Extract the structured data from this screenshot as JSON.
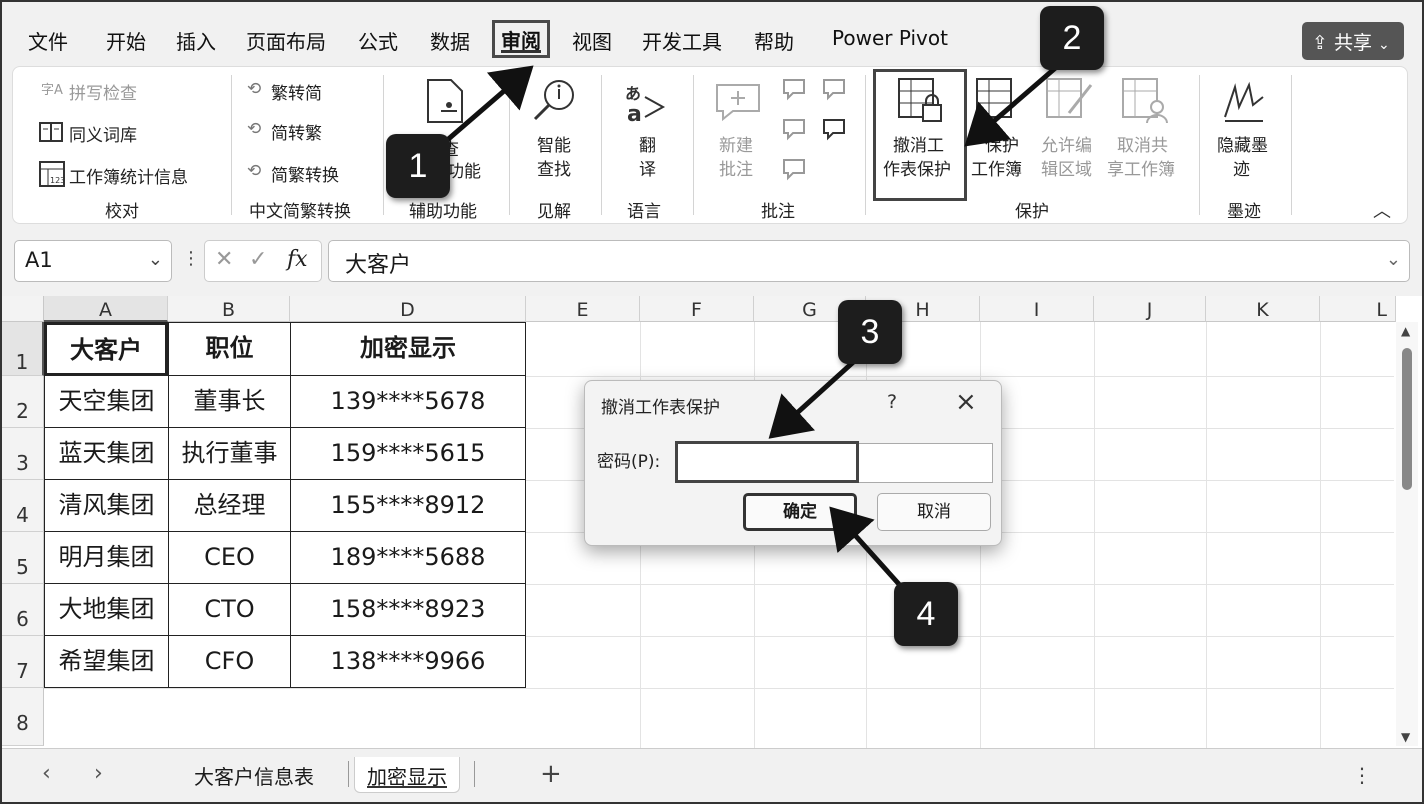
{
  "menu": {
    "file": "文件",
    "home": "开始",
    "insert": "插入",
    "layout": "页面布局",
    "formulas": "公式",
    "data": "数据",
    "review": "审阅",
    "view": "视图",
    "developer": "开发工具",
    "help": "帮助",
    "powerpivot": "Power Pivot",
    "share": "共享"
  },
  "ribbon": {
    "proofing": {
      "spell": "拼写检查",
      "thesaurus": "同义词库",
      "stats": "工作簿统计信息",
      "label": "校对"
    },
    "chinese": {
      "t2s": "繁转简",
      "s2t": "简转繁",
      "convert": "简繁转换",
      "label": "中文简繁转换"
    },
    "accessibility": {
      "check_line1": "检查",
      "check_line2": "辅助功能",
      "label": "辅助功能"
    },
    "insights": {
      "smart_line1": "智能",
      "smart_line2": "查找",
      "label": "见解"
    },
    "language": {
      "translate_line1": "翻",
      "translate_line2": "译",
      "label": "语言"
    },
    "comments": {
      "new_line1": "新建",
      "new_line2": "批注",
      "label": "批注"
    },
    "protect": {
      "unprotect_line1": "撤消工",
      "unprotect_line2": "作表保护",
      "workbook_line1": "保护",
      "workbook_line2": "工作簿",
      "allow_line1": "允许编",
      "allow_line2": "辑区域",
      "unshare_line1": "取消共",
      "unshare_line2": "享工作簿",
      "label": "保护"
    },
    "ink": {
      "hide_line1": "隐藏墨",
      "hide_line2": "迹",
      "label": "墨迹"
    }
  },
  "formula_bar": {
    "name_box": "A1",
    "fx": "fx",
    "content": "大客户"
  },
  "columns": [
    "A",
    "B",
    "D",
    "E",
    "F",
    "G",
    "H",
    "I",
    "J",
    "K",
    "L"
  ],
  "rows": [
    "1",
    "2",
    "3",
    "4",
    "5",
    "6",
    "7",
    "8"
  ],
  "table": {
    "headers": [
      "大客户",
      "职位",
      "加密显示"
    ],
    "rows": [
      [
        "天空集团",
        "董事长",
        "139****5678"
      ],
      [
        "蓝天集团",
        "执行董事",
        "159****5615"
      ],
      [
        "清风集团",
        "总经理",
        "155****8912"
      ],
      [
        "明月集团",
        "CEO",
        "189****5688"
      ],
      [
        "大地集团",
        "CTO",
        "158****8923"
      ],
      [
        "希望集团",
        "CFO",
        "138****9966"
      ]
    ]
  },
  "dialog": {
    "title": "撤消工作表保护",
    "help": "?",
    "password_label": "密码(P):",
    "password_value": "",
    "ok": "确定",
    "cancel": "取消"
  },
  "sheets": {
    "sheet1": "大客户信息表",
    "sheet2": "加密显示"
  },
  "callouts": [
    "1",
    "2",
    "3",
    "4"
  ]
}
